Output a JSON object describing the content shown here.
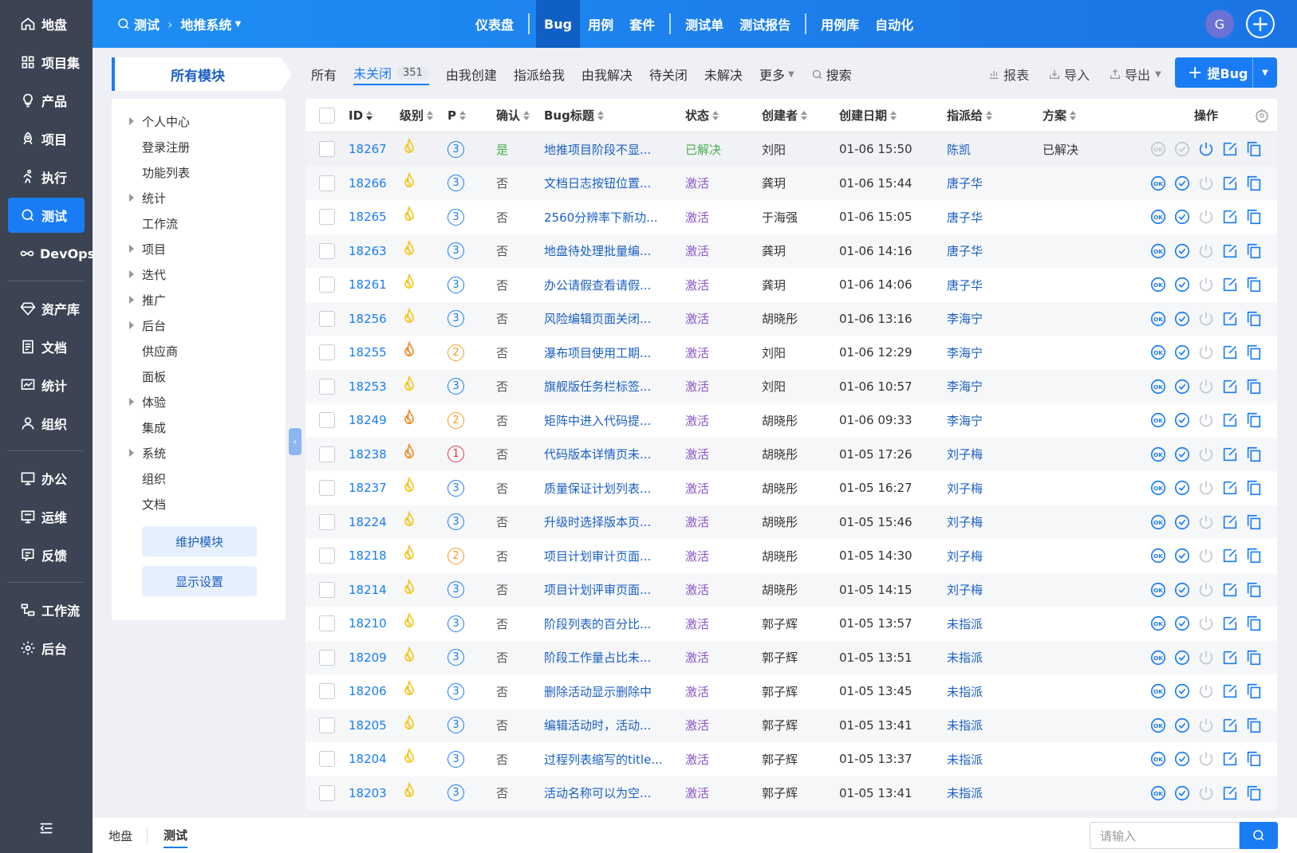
{
  "nav": {
    "items": [
      {
        "label": "地盘",
        "icon": "home-icon"
      },
      {
        "label": "项目集",
        "icon": "grid-icon"
      },
      {
        "label": "产品",
        "icon": "bulb-icon"
      },
      {
        "label": "项目",
        "icon": "rocket-icon"
      },
      {
        "label": "执行",
        "icon": "run-icon"
      },
      {
        "label": "测试",
        "icon": "search-test-icon",
        "active": true
      },
      {
        "label": "DevOps",
        "icon": "infinity-icon"
      }
    ],
    "items2": [
      {
        "label": "资产库",
        "icon": "diamond-icon"
      },
      {
        "label": "文档",
        "icon": "doc-icon"
      },
      {
        "label": "统计",
        "icon": "chart-icon"
      },
      {
        "label": "组织",
        "icon": "user-icon"
      }
    ],
    "items3": [
      {
        "label": "办公",
        "icon": "oa-icon"
      },
      {
        "label": "运维",
        "icon": "ops-icon"
      },
      {
        "label": "反馈",
        "icon": "feedback-icon"
      }
    ],
    "items4": [
      {
        "label": "工作流",
        "icon": "workflow-icon"
      },
      {
        "label": "后台",
        "icon": "settings-icon"
      }
    ]
  },
  "header": {
    "crumb_root": "测试",
    "crumb_product": "地推系统",
    "tabs": [
      "仪表盘",
      "Bug",
      "用例",
      "套件",
      "测试单",
      "测试报告",
      "用例库",
      "自动化"
    ],
    "active_tab": "Bug",
    "avatar": "G"
  },
  "toolbar": {
    "module_title": "所有模块",
    "tabs": [
      "所有",
      "未关闭",
      "由我创建",
      "指派给我",
      "由我解决",
      "待关闭",
      "未解决",
      "更多",
      "搜索"
    ],
    "open_count": "351",
    "report": "报表",
    "import": "导入",
    "export": "导出",
    "add_bug": "提Bug"
  },
  "tree": {
    "nodes": [
      {
        "label": "个人中心",
        "children": true
      },
      {
        "label": "登录注册",
        "children": false
      },
      {
        "label": "功能列表",
        "children": false
      },
      {
        "label": "统计",
        "children": true
      },
      {
        "label": "工作流",
        "children": false
      },
      {
        "label": "项目",
        "children": true
      },
      {
        "label": "迭代",
        "children": true
      },
      {
        "label": "推广",
        "children": true
      },
      {
        "label": "后台",
        "children": true
      },
      {
        "label": "供应商",
        "children": false
      },
      {
        "label": "面板",
        "children": false
      },
      {
        "label": "体验",
        "children": true
      },
      {
        "label": "集成",
        "children": false
      },
      {
        "label": "系统",
        "children": true
      },
      {
        "label": "组织",
        "children": false
      },
      {
        "label": "文档",
        "children": false
      }
    ],
    "maintain": "维护模块",
    "display": "显示设置"
  },
  "table": {
    "headers": {
      "id": "ID",
      "level": "级别",
      "pri": "P",
      "confirm": "确认",
      "title": "Bug标题",
      "status": "状态",
      "creator": "创建者",
      "date": "创建日期",
      "assignee": "指派给",
      "solution": "方案",
      "ops": "操作"
    },
    "rows": [
      {
        "id": "18267",
        "sev": 3,
        "pri": 3,
        "confirm": "是",
        "title": "地推项目阶段不显...",
        "status": "已解决",
        "creator": "刘阳",
        "date": "01-06 15:50",
        "assignee": "陈凯",
        "solution": "已解决"
      },
      {
        "id": "18266",
        "sev": 3,
        "pri": 3,
        "confirm": "否",
        "title": "文档日志按钮位置...",
        "status": "激活",
        "creator": "龚玥",
        "date": "01-06 15:44",
        "assignee": "唐子华",
        "solution": ""
      },
      {
        "id": "18265",
        "sev": 3,
        "pri": 3,
        "confirm": "否",
        "title": "2560分辨率下新功...",
        "status": "激活",
        "creator": "于海强",
        "date": "01-06 15:05",
        "assignee": "唐子华",
        "solution": ""
      },
      {
        "id": "18263",
        "sev": 3,
        "pri": 3,
        "confirm": "否",
        "title": "地盘待处理批量编...",
        "status": "激活",
        "creator": "龚玥",
        "date": "01-06 14:16",
        "assignee": "唐子华",
        "solution": ""
      },
      {
        "id": "18261",
        "sev": 3,
        "pri": 3,
        "confirm": "否",
        "title": "办公请假查看请假...",
        "status": "激活",
        "creator": "龚玥",
        "date": "01-06 14:06",
        "assignee": "唐子华",
        "solution": ""
      },
      {
        "id": "18256",
        "sev": 3,
        "pri": 3,
        "confirm": "否",
        "title": "风险编辑页面关闭...",
        "status": "激活",
        "creator": "胡晓彤",
        "date": "01-06 13:16",
        "assignee": "李海宁",
        "solution": ""
      },
      {
        "id": "18255",
        "sev": 2,
        "pri": 2,
        "confirm": "否",
        "title": "瀑布项目使用工期...",
        "status": "激活",
        "creator": "刘阳",
        "date": "01-06 12:29",
        "assignee": "李海宁",
        "solution": ""
      },
      {
        "id": "18253",
        "sev": 3,
        "pri": 3,
        "confirm": "否",
        "title": "旗舰版任务栏标签...",
        "status": "激活",
        "creator": "刘阳",
        "date": "01-06 10:57",
        "assignee": "李海宁",
        "solution": ""
      },
      {
        "id": "18249",
        "sev": 2,
        "pri": 2,
        "confirm": "否",
        "title": "矩阵中进入代码提...",
        "status": "激活",
        "creator": "胡晓彤",
        "date": "01-06 09:33",
        "assignee": "李海宁",
        "solution": ""
      },
      {
        "id": "18238",
        "sev": 2,
        "pri": 1,
        "confirm": "否",
        "title": "代码版本详情页未...",
        "status": "激活",
        "creator": "胡晓彤",
        "date": "01-05 17:26",
        "assignee": "刘子梅",
        "solution": ""
      },
      {
        "id": "18237",
        "sev": 3,
        "pri": 3,
        "confirm": "否",
        "title": "质量保证计划列表...",
        "status": "激活",
        "creator": "胡晓彤",
        "date": "01-05 16:27",
        "assignee": "刘子梅",
        "solution": ""
      },
      {
        "id": "18224",
        "sev": 3,
        "pri": 3,
        "confirm": "否",
        "title": "升级时选择版本页...",
        "status": "激活",
        "creator": "胡晓彤",
        "date": "01-05 15:46",
        "assignee": "刘子梅",
        "solution": ""
      },
      {
        "id": "18218",
        "sev": 3,
        "pri": 2,
        "confirm": "否",
        "title": "项目计划审计页面...",
        "status": "激活",
        "creator": "胡晓彤",
        "date": "01-05 14:30",
        "assignee": "刘子梅",
        "solution": ""
      },
      {
        "id": "18214",
        "sev": 3,
        "pri": 3,
        "confirm": "否",
        "title": "项目计划评审页面...",
        "status": "激活",
        "creator": "胡晓彤",
        "date": "01-05 14:15",
        "assignee": "刘子梅",
        "solution": ""
      },
      {
        "id": "18210",
        "sev": 3,
        "pri": 3,
        "confirm": "否",
        "title": "阶段列表的百分比...",
        "status": "激活",
        "creator": "郭子辉",
        "date": "01-05 13:57",
        "assignee": "未指派",
        "solution": ""
      },
      {
        "id": "18209",
        "sev": 3,
        "pri": 3,
        "confirm": "否",
        "title": "阶段工作量占比未...",
        "status": "激活",
        "creator": "郭子辉",
        "date": "01-05 13:51",
        "assignee": "未指派",
        "solution": ""
      },
      {
        "id": "18206",
        "sev": 3,
        "pri": 3,
        "confirm": "否",
        "title": "删除活动显示删除中",
        "status": "激活",
        "creator": "郭子辉",
        "date": "01-05 13:45",
        "assignee": "未指派",
        "solution": ""
      },
      {
        "id": "18205",
        "sev": 3,
        "pri": 3,
        "confirm": "否",
        "title": "编辑活动时，活动...",
        "status": "激活",
        "creator": "郭子辉",
        "date": "01-05 13:41",
        "assignee": "未指派",
        "solution": ""
      },
      {
        "id": "18204",
        "sev": 3,
        "pri": 3,
        "confirm": "否",
        "title": "过程列表缩写的title...",
        "status": "激活",
        "creator": "郭子辉",
        "date": "01-05 13:37",
        "assignee": "未指派",
        "solution": ""
      },
      {
        "id": "18203",
        "sev": 3,
        "pri": 3,
        "confirm": "否",
        "title": "活动名称可以为空...",
        "status": "激活",
        "creator": "郭子辉",
        "date": "01-05 13:41",
        "assignee": "未指派",
        "solution": ""
      }
    ]
  },
  "footer": {
    "tabs": [
      "地盘",
      "测试"
    ],
    "active": "测试",
    "search_placeholder": "请输入"
  },
  "colors": {
    "accent": "#1a7cf4",
    "sidebar": "#3c4353",
    "status_active": "#8c56c8",
    "status_resolved": "#4caf50",
    "sev3": "#f5c518",
    "sev2": "#f08a24"
  }
}
